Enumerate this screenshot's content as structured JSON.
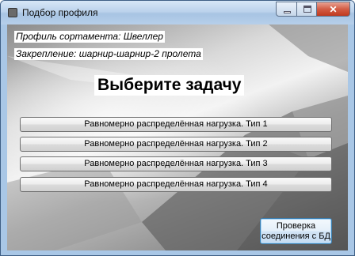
{
  "window": {
    "title": "Подбор профиля",
    "controls": {
      "minimize": "",
      "maximize": "",
      "close": "✕"
    }
  },
  "info": {
    "profile": "Профиль сортамента: Швеллер",
    "fixing": "Закрепление: шарнир-шарнир-2 пролета"
  },
  "heading": "Выберите задачу",
  "tasks": [
    "Равномерно распределённая нагрузка. Тип 1",
    "Равномерно распределённая нагрузка. Тип 2",
    "Равномерно распределённая нагрузка. Тип 3",
    "Равномерно распределённая нагрузка. Тип 4"
  ],
  "db_button": {
    "line1": "Проверка",
    "line2": "соединения с БД"
  },
  "colors": {
    "frame": "#a9c7e6",
    "close": "#c0391f",
    "accent_border": "#3c7fb1"
  },
  "icons": {
    "app": "app-icon",
    "minimize": "minimize-icon",
    "maximize": "maximize-icon",
    "close": "close-icon"
  }
}
